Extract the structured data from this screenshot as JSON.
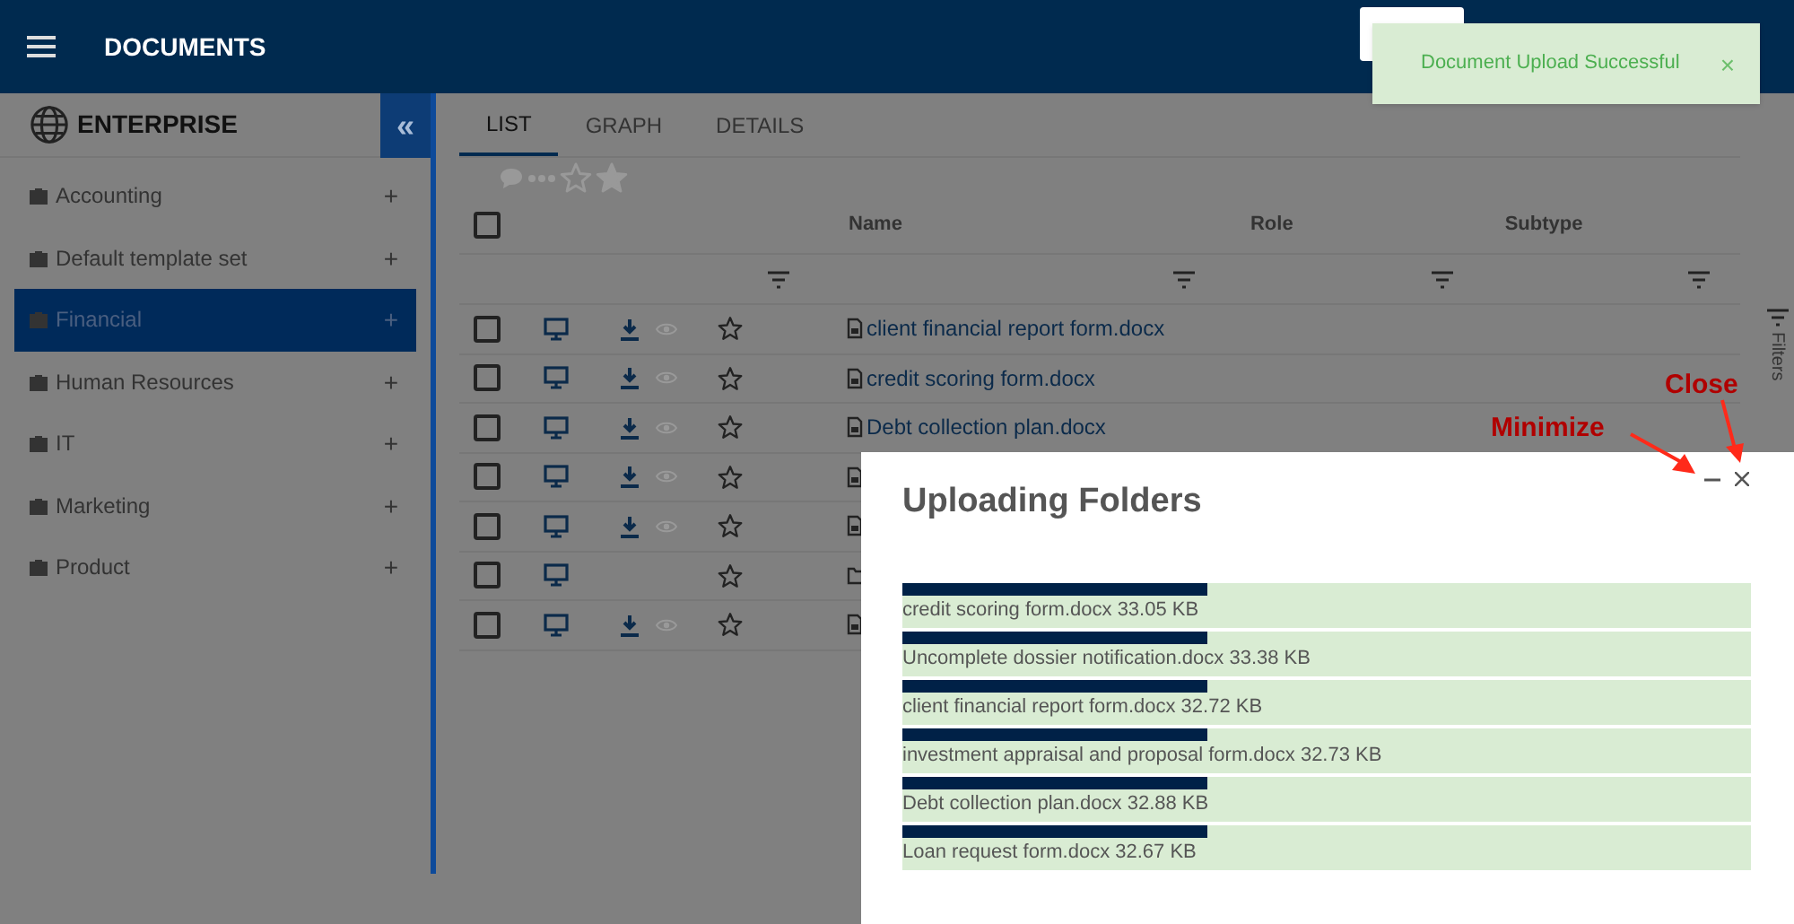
{
  "header": {
    "title": "DOCUMENTS"
  },
  "toast": {
    "message": "Document Upload Successful",
    "close": "×"
  },
  "sidebar": {
    "title": "ENTERPRISE",
    "collapse": "«",
    "items": [
      {
        "label": "Accounting",
        "selected": false,
        "action": "+"
      },
      {
        "label": "Default template set",
        "selected": false,
        "action": "+"
      },
      {
        "label": "Financial",
        "selected": true,
        "action": "+"
      },
      {
        "label": "Human Resources",
        "selected": false,
        "action": "+"
      },
      {
        "label": "IT",
        "selected": false,
        "action": "+"
      },
      {
        "label": "Marketing",
        "selected": false,
        "action": "+"
      },
      {
        "label": "Product",
        "selected": false,
        "action": "+"
      }
    ]
  },
  "tabs": [
    {
      "label": "LIST",
      "selected": true
    },
    {
      "label": "GRAPH",
      "selected": false
    },
    {
      "label": "DETAILS",
      "selected": false
    }
  ],
  "table": {
    "columns": [
      "Name",
      "Role",
      "Subtype"
    ],
    "all_checked": false,
    "rows": [
      {
        "kind": "file",
        "checked": false,
        "download": true,
        "name": "client financial report form.docx"
      },
      {
        "kind": "file",
        "checked": false,
        "download": true,
        "name": "credit scoring form.docx"
      },
      {
        "kind": "file",
        "checked": false,
        "download": true,
        "name": "Debt collection plan.docx"
      },
      {
        "kind": "file",
        "checked": false,
        "download": true
      },
      {
        "kind": "file",
        "checked": false,
        "download": true
      },
      {
        "kind": "folder",
        "checked": false,
        "download": false
      },
      {
        "kind": "file",
        "checked": false,
        "download": true
      }
    ]
  },
  "filters_label": "Filters",
  "dialog": {
    "title": "Uploading Folders",
    "uploads": [
      {
        "label": "credit scoring form.docx 33.05 KB",
        "level": 0.36
      },
      {
        "label": "Uncomplete dossier notification.docx 33.38 KB",
        "level": 0.36
      },
      {
        "label": "client financial report form.docx 32.72 KB",
        "level": 0.36
      },
      {
        "label": "investment appraisal and proposal form.docx 32.73 KB",
        "level": 0.36
      },
      {
        "label": "Debt collection plan.docx 32.88 KB",
        "level": 0.36
      },
      {
        "label": "Loan request form.docx 32.67 KB",
        "level": 0.36
      }
    ]
  },
  "annotations": [
    {
      "label": "Minimize"
    },
    {
      "label": "Close"
    }
  ]
}
